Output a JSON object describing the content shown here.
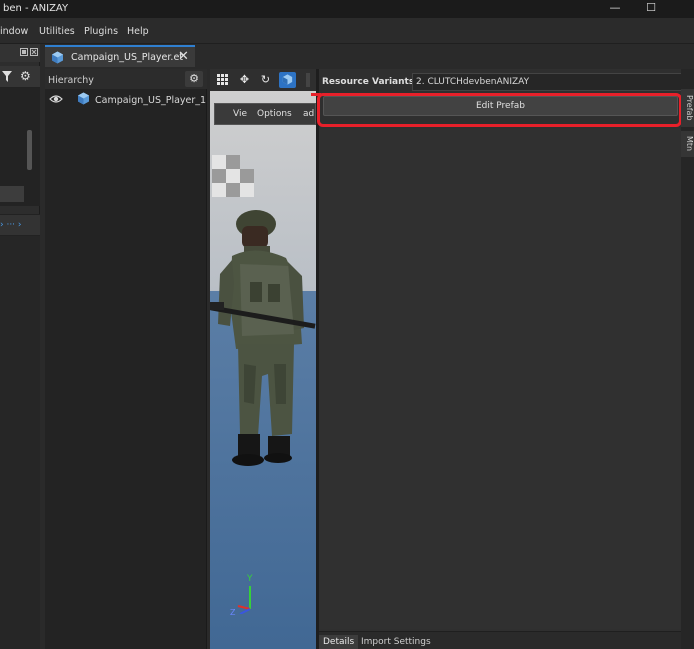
{
  "window": {
    "title": "ben - ANIZAY",
    "minimize": "—",
    "maximize": "☐"
  },
  "menubar": {
    "items": [
      "indow",
      "Utilities",
      "Plugins",
      "Help"
    ]
  },
  "document_tab": {
    "label": "Campaign_US_Player.et",
    "close": "✕"
  },
  "hierarchy": {
    "title": "Hierarchy",
    "items": [
      {
        "label": "Campaign_US_Player_1"
      }
    ]
  },
  "viewport": {
    "menu": [
      "Vie",
      "Options",
      "ad"
    ],
    "axis": {
      "y": "Y",
      "z": "Z"
    }
  },
  "details": {
    "resource_variants_label": "Resource Variants (2)",
    "variant_selected": "2. CLUTCHdevbenANIZAY",
    "edit_prefab": "Edit Prefab",
    "tabs": [
      "Details",
      "Import Settings"
    ]
  },
  "side_tabs": [
    "Prefab",
    "Mtn"
  ],
  "left_panel": {
    "nav": "› ··· ›"
  },
  "colors": {
    "accent": "#2f7fd0",
    "annotation": "#e8202a"
  }
}
